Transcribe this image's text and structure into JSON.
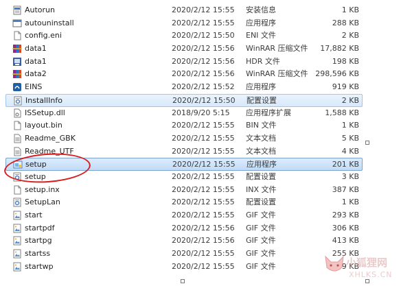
{
  "files": [
    {
      "name": "Autorun",
      "date": "2020/2/12 15:55",
      "type": "安装信息",
      "size": "1 KB",
      "icon": "setup-info-icon"
    },
    {
      "name": "autouninstall",
      "date": "2020/2/12 15:55",
      "type": "应用程序",
      "size": "288 KB",
      "icon": "exe-icon"
    },
    {
      "name": "config.eni",
      "date": "2020/2/12 15:50",
      "type": "ENI 文件",
      "size": "2 KB",
      "icon": "file-icon"
    },
    {
      "name": "data1",
      "date": "2020/2/12 15:56",
      "type": "WinRAR 压缩文件",
      "size": "17,882 KB",
      "icon": "winrar-icon"
    },
    {
      "name": "data1",
      "date": "2020/2/12 15:56",
      "type": "HDR 文件",
      "size": "198 KB",
      "icon": "hdr-icon"
    },
    {
      "name": "data2",
      "date": "2020/2/12 15:56",
      "type": "WinRAR 压缩文件",
      "size": "298,596 KB",
      "icon": "winrar-icon"
    },
    {
      "name": "EINS",
      "date": "2020/2/12 15:52",
      "type": "应用程序",
      "size": "919 KB",
      "icon": "app-icon"
    },
    {
      "name": "InstallInfo",
      "date": "2020/2/12 15:50",
      "type": "配置设置",
      "size": "2 KB",
      "icon": "config-icon"
    },
    {
      "name": "ISSetup.dll",
      "date": "2018/9/20 5:15",
      "type": "应用程序扩展",
      "size": "1,588 KB",
      "icon": "dll-icon"
    },
    {
      "name": "layout.bin",
      "date": "2020/2/12 15:55",
      "type": "BIN 文件",
      "size": "1 KB",
      "icon": "file-icon"
    },
    {
      "name": "Readme_GBK",
      "date": "2020/2/12 15:55",
      "type": "文本文档",
      "size": "5 KB",
      "icon": "text-icon"
    },
    {
      "name": "Readme_UTF",
      "date": "2020/2/12 15:55",
      "type": "文本文档",
      "size": "4 KB",
      "icon": "text-icon"
    },
    {
      "name": "setup",
      "date": "2020/2/12 15:55",
      "type": "应用程序",
      "size": "201 KB",
      "icon": "setup-app-icon"
    },
    {
      "name": "setup",
      "date": "2020/2/12 15:55",
      "type": "配置设置",
      "size": "3 KB",
      "icon": "config-icon"
    },
    {
      "name": "setup.inx",
      "date": "2020/2/12 15:55",
      "type": "INX 文件",
      "size": "387 KB",
      "icon": "file-icon"
    },
    {
      "name": "SetupLan",
      "date": "2020/2/12 15:55",
      "type": "配置设置",
      "size": "1 KB",
      "icon": "config-icon"
    },
    {
      "name": "start",
      "date": "2020/2/12 15:55",
      "type": "GIF 文件",
      "size": "293 KB",
      "icon": "gif-icon"
    },
    {
      "name": "startpdf",
      "date": "2020/2/12 15:56",
      "type": "GIF 文件",
      "size": "306 KB",
      "icon": "gif-icon"
    },
    {
      "name": "startpg",
      "date": "2020/2/12 15:56",
      "type": "GIF 文件",
      "size": "413 KB",
      "icon": "gif-icon"
    },
    {
      "name": "startss",
      "date": "2020/2/12 15:55",
      "type": "GIF 文件",
      "size": "255 KB",
      "icon": "gif-icon"
    },
    {
      "name": "startwp",
      "date": "2020/2/12 15:55",
      "type": "GIF 文件",
      "size": "209 KB",
      "icon": "gif-icon"
    }
  ],
  "hover_index": 7,
  "selected_index": 12,
  "annotation_color": "#d81d1d",
  "watermark": {
    "text": "小狐狸网",
    "url": "XHLKS.CN"
  }
}
